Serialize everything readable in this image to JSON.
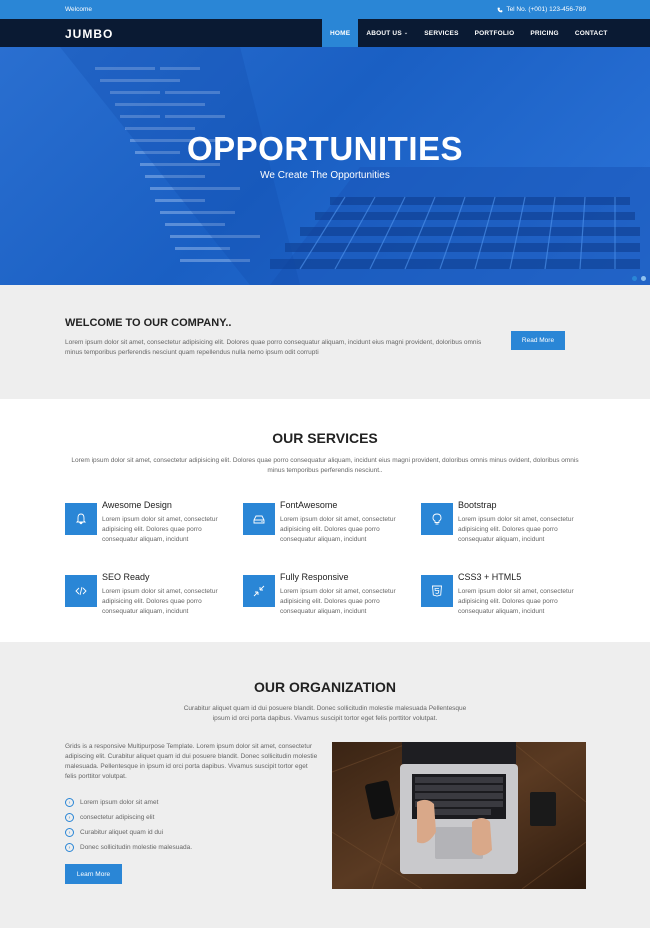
{
  "topbar": {
    "welcome": "Welcome",
    "phone": "Tel No. (+001) 123-456-789"
  },
  "nav": {
    "logo": "JUMBO",
    "items": [
      "HOME",
      "ABOUT US",
      "SERVICES",
      "PORTFOLIO",
      "PRICING",
      "CONTACT"
    ],
    "active": "HOME"
  },
  "hero": {
    "title": "OPPORTUNITIES",
    "subtitle": "We Create The Opportunities"
  },
  "welcome": {
    "title": "WELCOME TO OUR COMPANY..",
    "text": "Lorem ipsum dolor sit amet, consectetur adipisicing elit. Dolores quae porro consequatur aliquam, incidunt eius magni provident, doloribus omnis minus temporibus perferendis nesciunt quam repellendus nulla nemo ipsum odit corrupti",
    "button": "Read More"
  },
  "services": {
    "title": "OUR SERVICES",
    "intro": "Lorem ipsum dolor sit amet, consectetur adipisicing elit. Dolores quae porro consequatur aliquam, incidunt eius magni provident, doloribus omnis minus ovident, doloribus omnis minus temporibus perferendis nesciunt..",
    "items": [
      {
        "title": "Awesome Design",
        "icon": "bell-icon",
        "text": "Lorem ipsum dolor sit amet, consectetur adipisicing elit. Dolores quae porro consequatur aliquam, incidunt"
      },
      {
        "title": "FontAwesome",
        "icon": "hdd-icon",
        "text": "Lorem ipsum dolor sit amet, consectetur adipisicing elit. Dolores quae porro consequatur aliquam, incidunt"
      },
      {
        "title": "Bootstrap",
        "icon": "lightbulb-icon",
        "text": "Lorem ipsum dolor sit amet, consectetur adipisicing elit. Dolores quae porro consequatur aliquam, incidunt"
      },
      {
        "title": "SEO Ready",
        "icon": "code-icon",
        "text": "Lorem ipsum dolor sit amet, consectetur adipisicing elit. Dolores quae porro consequatur aliquam, incidunt"
      },
      {
        "title": "Fully Responsive",
        "icon": "compress-icon",
        "text": "Lorem ipsum dolor sit amet, consectetur adipisicing elit. Dolores quae porro consequatur aliquam, incidunt"
      },
      {
        "title": "CSS3 + HTML5",
        "icon": "html5-icon",
        "text": "Lorem ipsum dolor sit amet, consectetur adipisicing elit. Dolores quae porro consequatur aliquam, incidunt"
      }
    ]
  },
  "org": {
    "title": "OUR ORGANIZATION",
    "intro": "Curabitur aliquet quam id dui posuere blandit. Donec sollicitudin molestie malesuada Pellentesque ipsum id orci porta dapibus. Vivamus suscipit tortor eget felis porttitor volutpat.",
    "text": "Grids is a responsive Multipurpose Template. Lorem ipsum dolor sit amet, consectetur adipiscing elit. Curabitur aliquet quam id dui posuere blandit. Donec sollicitudin molestie malesuada. Pellentesque in ipsum id orci porta dapibus. Vivamus suscipit tortor eget felis porttitor volutpat.",
    "list": [
      "Lorem ipsum dolor sit amet",
      "consectetur adipiscing elit",
      "Curabitur aliquet quam id dui",
      "Donec sollicitudin molestie malesuada."
    ],
    "button": "Learn More"
  },
  "colors": {
    "accent": "#2a86d6",
    "nav_bg": "#0a1a33",
    "section_gray": "#eeeeee"
  }
}
